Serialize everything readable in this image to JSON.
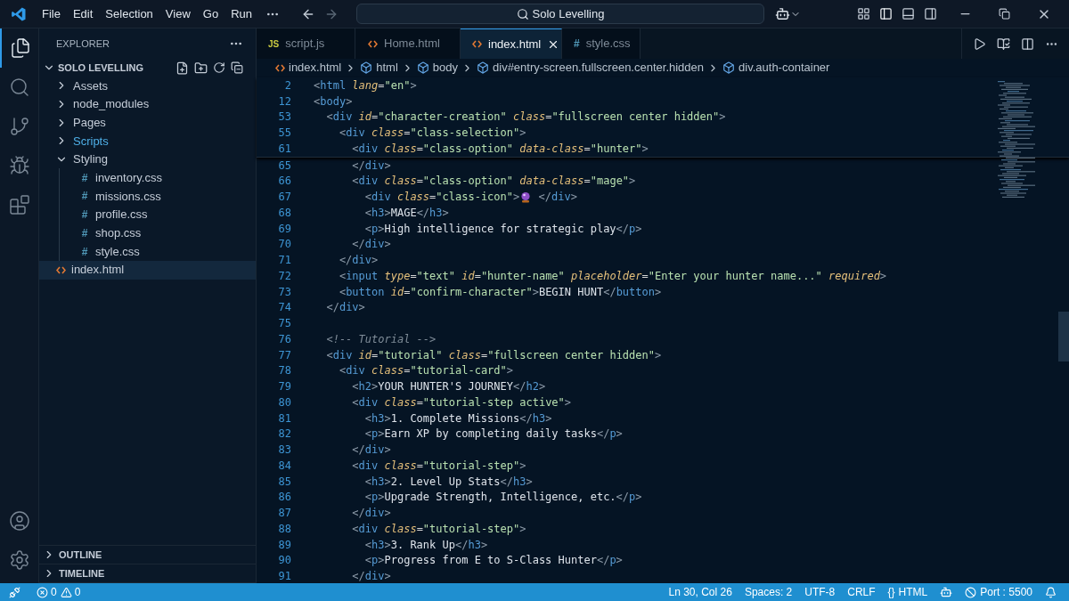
{
  "title_bar": {
    "menus": [
      "File",
      "Edit",
      "Selection",
      "View",
      "Go",
      "Run"
    ],
    "search": {
      "value": "Solo Levelling"
    }
  },
  "activity_bar": [
    {
      "kind": "files",
      "selected": true
    },
    {
      "kind": "search",
      "selected": false
    },
    {
      "kind": "source-control",
      "selected": false
    },
    {
      "kind": "debug",
      "selected": false
    },
    {
      "kind": "extensions",
      "selected": false
    }
  ],
  "explorer": {
    "title": "EXPLORER",
    "project": "SOLO LEVELLING",
    "tree": [
      {
        "name": "Assets",
        "kind": "folder",
        "expanded": false,
        "selected": false,
        "color": "#c5cdd8"
      },
      {
        "name": "node_modules",
        "kind": "folder",
        "expanded": false,
        "selected": false,
        "color": "#c5cdd8"
      },
      {
        "name": "Pages",
        "kind": "folder",
        "expanded": false,
        "selected": false,
        "color": "#c5cdd8"
      },
      {
        "name": "Scripts",
        "kind": "folder",
        "expanded": false,
        "selected": false,
        "color": "#4fb0e8"
      },
      {
        "name": "Styling",
        "kind": "folder",
        "expanded": true,
        "selected": false,
        "color": "#c5cdd8",
        "children": [
          {
            "name": "inventory.css",
            "kind": "css",
            "badge": "#",
            "selected": false,
            "color": "#c5cdd8"
          },
          {
            "name": "missions.css",
            "kind": "css",
            "badge": "#",
            "selected": false,
            "color": "#c5cdd8"
          },
          {
            "name": "profile.css",
            "kind": "css",
            "badge": "#",
            "selected": false,
            "color": "#c5cdd8"
          },
          {
            "name": "shop.css",
            "kind": "css",
            "badge": "#",
            "selected": false,
            "color": "#c5cdd8"
          },
          {
            "name": "style.css",
            "kind": "css",
            "badge": "#",
            "selected": false,
            "color": "#c5cdd8"
          }
        ]
      },
      {
        "name": "index.html",
        "kind": "html",
        "selected": true,
        "color": "#c5cdd8"
      }
    ],
    "sections": [
      "OUTLINE",
      "TIMELINE"
    ]
  },
  "tabs": [
    {
      "label": "script.js",
      "kind": "js",
      "badge": "JS",
      "selected": false
    },
    {
      "label": "Home.html",
      "kind": "html",
      "selected": false
    },
    {
      "label": "index.html",
      "kind": "html",
      "selected": true
    },
    {
      "label": "style.css",
      "kind": "css",
      "badge": "#",
      "selected": false
    }
  ],
  "breadcrumb": [
    {
      "label": "index.html",
      "kind": "file"
    },
    {
      "label": "html",
      "kind": "element"
    },
    {
      "label": "body",
      "kind": "element"
    },
    {
      "label": "div#entry-screen.fullscreen.center.hidden",
      "kind": "element"
    },
    {
      "label": "div.auth-container",
      "kind": "element"
    }
  ],
  "sticky_lines": [
    {
      "n": "2",
      "tokens": [
        {
          "kind": "bracket",
          "text": "<"
        },
        {
          "kind": "tag",
          "text": "html"
        },
        {
          "kind": "attr",
          "text": " lang"
        },
        {
          "kind": "eq",
          "text": "="
        },
        {
          "kind": "string",
          "text": "\"en\""
        },
        {
          "kind": "bracket",
          "text": ">"
        }
      ]
    },
    {
      "n": "12",
      "tokens": [
        {
          "kind": "bracket",
          "text": "<"
        },
        {
          "kind": "tag",
          "text": "body"
        },
        {
          "kind": "bracket",
          "text": ">"
        }
      ]
    },
    {
      "n": "53",
      "tokens": [
        {
          "kind": "bracket",
          "text": "  <"
        },
        {
          "kind": "tag",
          "text": "div"
        },
        {
          "kind": "attr",
          "text": " id"
        },
        {
          "kind": "eq",
          "text": "="
        },
        {
          "kind": "string",
          "text": "\"character-creation\""
        },
        {
          "kind": "attr",
          "text": " class"
        },
        {
          "kind": "eq",
          "text": "="
        },
        {
          "kind": "string",
          "text": "\"fullscreen center hidden\""
        },
        {
          "kind": "bracket",
          "text": ">"
        }
      ]
    },
    {
      "n": "55",
      "tokens": [
        {
          "kind": "bracket",
          "text": "    <"
        },
        {
          "kind": "tag",
          "text": "div"
        },
        {
          "kind": "attr",
          "text": " class"
        },
        {
          "kind": "eq",
          "text": "="
        },
        {
          "kind": "string",
          "text": "\"class-selection\""
        },
        {
          "kind": "bracket",
          "text": ">"
        }
      ]
    },
    {
      "n": "61",
      "tokens": [
        {
          "kind": "bracket",
          "text": "      <"
        },
        {
          "kind": "tag",
          "text": "div"
        },
        {
          "kind": "attr",
          "text": " class"
        },
        {
          "kind": "eq",
          "text": "="
        },
        {
          "kind": "string",
          "text": "\"class-option\""
        },
        {
          "kind": "attr",
          "text": " data-class"
        },
        {
          "kind": "eq",
          "text": "="
        },
        {
          "kind": "string",
          "text": "\"hunter\""
        },
        {
          "kind": "bracket",
          "text": ">"
        }
      ]
    }
  ],
  "lines": [
    {
      "n": "65",
      "tokens": [
        {
          "kind": "bracket",
          "text": "      </"
        },
        {
          "kind": "tag",
          "text": "div"
        },
        {
          "kind": "bracket",
          "text": ">"
        }
      ]
    },
    {
      "n": "66",
      "tokens": [
        {
          "kind": "bracket",
          "text": "      <"
        },
        {
          "kind": "tag",
          "text": "div"
        },
        {
          "kind": "attr",
          "text": " class"
        },
        {
          "kind": "eq",
          "text": "="
        },
        {
          "kind": "string",
          "text": "\"class-option\""
        },
        {
          "kind": "attr",
          "text": " data-class"
        },
        {
          "kind": "eq",
          "text": "="
        },
        {
          "kind": "string",
          "text": "\"mage\""
        },
        {
          "kind": "bracket",
          "text": ">"
        }
      ]
    },
    {
      "n": "67",
      "tokens": [
        {
          "kind": "bracket",
          "text": "        <"
        },
        {
          "kind": "tag",
          "text": "div"
        },
        {
          "kind": "attr",
          "text": " class"
        },
        {
          "kind": "eq",
          "text": "="
        },
        {
          "kind": "string",
          "text": "\"class-icon\""
        },
        {
          "kind": "bracket",
          "text": ">"
        },
        {
          "kind": "icon"
        },
        {
          "kind": "bracket",
          "text": " </"
        },
        {
          "kind": "tag",
          "text": "div"
        },
        {
          "kind": "bracket",
          "text": ">"
        }
      ]
    },
    {
      "n": "68",
      "tokens": [
        {
          "kind": "bracket",
          "text": "        <"
        },
        {
          "kind": "tag",
          "text": "h3"
        },
        {
          "kind": "bracket",
          "text": ">"
        },
        {
          "kind": "text",
          "text": "MAGE"
        },
        {
          "kind": "bracket",
          "text": "</"
        },
        {
          "kind": "tag",
          "text": "h3"
        },
        {
          "kind": "bracket",
          "text": ">"
        }
      ]
    },
    {
      "n": "69",
      "tokens": [
        {
          "kind": "bracket",
          "text": "        <"
        },
        {
          "kind": "tag",
          "text": "p"
        },
        {
          "kind": "bracket",
          "text": ">"
        },
        {
          "kind": "text",
          "text": "High intelligence for strategic play"
        },
        {
          "kind": "bracket",
          "text": "</"
        },
        {
          "kind": "tag",
          "text": "p"
        },
        {
          "kind": "bracket",
          "text": ">"
        }
      ]
    },
    {
      "n": "70",
      "tokens": [
        {
          "kind": "bracket",
          "text": "      </"
        },
        {
          "kind": "tag",
          "text": "div"
        },
        {
          "kind": "bracket",
          "text": ">"
        }
      ]
    },
    {
      "n": "71",
      "tokens": [
        {
          "kind": "bracket",
          "text": "    </"
        },
        {
          "kind": "tag",
          "text": "div"
        },
        {
          "kind": "bracket",
          "text": ">"
        }
      ]
    },
    {
      "n": "72",
      "tokens": [
        {
          "kind": "bracket",
          "text": "    <"
        },
        {
          "kind": "tag",
          "text": "input"
        },
        {
          "kind": "attr",
          "text": " type"
        },
        {
          "kind": "eq",
          "text": "="
        },
        {
          "kind": "string",
          "text": "\"text\""
        },
        {
          "kind": "attr",
          "text": " id"
        },
        {
          "kind": "eq",
          "text": "="
        },
        {
          "kind": "string",
          "text": "\"hunter-name\""
        },
        {
          "kind": "attr",
          "text": " placeholder"
        },
        {
          "kind": "eq",
          "text": "="
        },
        {
          "kind": "string",
          "text": "\"Enter your hunter name...\""
        },
        {
          "kind": "attr",
          "text": " required"
        },
        {
          "kind": "bracket",
          "text": ">"
        }
      ]
    },
    {
      "n": "73",
      "tokens": [
        {
          "kind": "bracket",
          "text": "    <"
        },
        {
          "kind": "tag",
          "text": "button"
        },
        {
          "kind": "attr",
          "text": " id"
        },
        {
          "kind": "eq",
          "text": "="
        },
        {
          "kind": "string",
          "text": "\"confirm-character\""
        },
        {
          "kind": "bracket",
          "text": ">"
        },
        {
          "kind": "text",
          "text": "BEGIN HUNT"
        },
        {
          "kind": "bracket",
          "text": "</"
        },
        {
          "kind": "tag",
          "text": "button"
        },
        {
          "kind": "bracket",
          "text": ">"
        }
      ]
    },
    {
      "n": "74",
      "tokens": [
        {
          "kind": "bracket",
          "text": "  </"
        },
        {
          "kind": "tag",
          "text": "div"
        },
        {
          "kind": "bracket",
          "text": ">"
        }
      ]
    },
    {
      "n": "75"
    },
    {
      "n": "76",
      "tokens": [
        {
          "kind": "comment",
          "text": "  <!-- Tutorial -->"
        }
      ]
    },
    {
      "n": "77",
      "tokens": [
        {
          "kind": "bracket",
          "text": "  <"
        },
        {
          "kind": "tag",
          "text": "div"
        },
        {
          "kind": "attr",
          "text": " id"
        },
        {
          "kind": "eq",
          "text": "="
        },
        {
          "kind": "string",
          "text": "\"tutorial\""
        },
        {
          "kind": "attr",
          "text": " class"
        },
        {
          "kind": "eq",
          "text": "="
        },
        {
          "kind": "string",
          "text": "\"fullscreen center hidden\""
        },
        {
          "kind": "bracket",
          "text": ">"
        }
      ]
    },
    {
      "n": "78",
      "tokens": [
        {
          "kind": "bracket",
          "text": "    <"
        },
        {
          "kind": "tag",
          "text": "div"
        },
        {
          "kind": "attr",
          "text": " class"
        },
        {
          "kind": "eq",
          "text": "="
        },
        {
          "kind": "string",
          "text": "\"tutorial-card\""
        },
        {
          "kind": "bracket",
          "text": ">"
        }
      ]
    },
    {
      "n": "79",
      "tokens": [
        {
          "kind": "bracket",
          "text": "      <"
        },
        {
          "kind": "tag",
          "text": "h2"
        },
        {
          "kind": "bracket",
          "text": ">"
        },
        {
          "kind": "text",
          "text": "YOUR HUNTER'S JOURNEY"
        },
        {
          "kind": "bracket",
          "text": "</"
        },
        {
          "kind": "tag",
          "text": "h2"
        },
        {
          "kind": "bracket",
          "text": ">"
        }
      ]
    },
    {
      "n": "80",
      "tokens": [
        {
          "kind": "bracket",
          "text": "      <"
        },
        {
          "kind": "tag",
          "text": "div"
        },
        {
          "kind": "attr",
          "text": " class"
        },
        {
          "kind": "eq",
          "text": "="
        },
        {
          "kind": "string",
          "text": "\"tutorial-step active\""
        },
        {
          "kind": "bracket",
          "text": ">"
        }
      ]
    },
    {
      "n": "81",
      "tokens": [
        {
          "kind": "bracket",
          "text": "        <"
        },
        {
          "kind": "tag",
          "text": "h3"
        },
        {
          "kind": "bracket",
          "text": ">"
        },
        {
          "kind": "text",
          "text": "1. Complete Missions"
        },
        {
          "kind": "bracket",
          "text": "</"
        },
        {
          "kind": "tag",
          "text": "h3"
        },
        {
          "kind": "bracket",
          "text": ">"
        }
      ]
    },
    {
      "n": "82",
      "tokens": [
        {
          "kind": "bracket",
          "text": "        <"
        },
        {
          "kind": "tag",
          "text": "p"
        },
        {
          "kind": "bracket",
          "text": ">"
        },
        {
          "kind": "text",
          "text": "Earn XP by completing daily tasks"
        },
        {
          "kind": "bracket",
          "text": "</"
        },
        {
          "kind": "tag",
          "text": "p"
        },
        {
          "kind": "bracket",
          "text": ">"
        }
      ]
    },
    {
      "n": "83",
      "tokens": [
        {
          "kind": "bracket",
          "text": "      </"
        },
        {
          "kind": "tag",
          "text": "div"
        },
        {
          "kind": "bracket",
          "text": ">"
        }
      ]
    },
    {
      "n": "84",
      "tokens": [
        {
          "kind": "bracket",
          "text": "      <"
        },
        {
          "kind": "tag",
          "text": "div"
        },
        {
          "kind": "attr",
          "text": " class"
        },
        {
          "kind": "eq",
          "text": "="
        },
        {
          "kind": "string",
          "text": "\"tutorial-step\""
        },
        {
          "kind": "bracket",
          "text": ">"
        }
      ]
    },
    {
      "n": "85",
      "tokens": [
        {
          "kind": "bracket",
          "text": "        <"
        },
        {
          "kind": "tag",
          "text": "h3"
        },
        {
          "kind": "bracket",
          "text": ">"
        },
        {
          "kind": "text",
          "text": "2. Level Up Stats"
        },
        {
          "kind": "bracket",
          "text": "</"
        },
        {
          "kind": "tag",
          "text": "h3"
        },
        {
          "kind": "bracket",
          "text": ">"
        }
      ]
    },
    {
      "n": "86",
      "tokens": [
        {
          "kind": "bracket",
          "text": "        <"
        },
        {
          "kind": "tag",
          "text": "p"
        },
        {
          "kind": "bracket",
          "text": ">"
        },
        {
          "kind": "text",
          "text": "Upgrade Strength, Intelligence, etc."
        },
        {
          "kind": "bracket",
          "text": "</"
        },
        {
          "kind": "tag",
          "text": "p"
        },
        {
          "kind": "bracket",
          "text": ">"
        }
      ]
    },
    {
      "n": "87",
      "tokens": [
        {
          "kind": "bracket",
          "text": "      </"
        },
        {
          "kind": "tag",
          "text": "div"
        },
        {
          "kind": "bracket",
          "text": ">"
        }
      ]
    },
    {
      "n": "88",
      "tokens": [
        {
          "kind": "bracket",
          "text": "      <"
        },
        {
          "kind": "tag",
          "text": "div"
        },
        {
          "kind": "attr",
          "text": " class"
        },
        {
          "kind": "eq",
          "text": "="
        },
        {
          "kind": "string",
          "text": "\"tutorial-step\""
        },
        {
          "kind": "bracket",
          "text": ">"
        }
      ]
    },
    {
      "n": "89",
      "tokens": [
        {
          "kind": "bracket",
          "text": "        <"
        },
        {
          "kind": "tag",
          "text": "h3"
        },
        {
          "kind": "bracket",
          "text": ">"
        },
        {
          "kind": "text",
          "text": "3. Rank Up"
        },
        {
          "kind": "bracket",
          "text": "</"
        },
        {
          "kind": "tag",
          "text": "h3"
        },
        {
          "kind": "bracket",
          "text": ">"
        }
      ]
    },
    {
      "n": "90",
      "tokens": [
        {
          "kind": "bracket",
          "text": "        <"
        },
        {
          "kind": "tag",
          "text": "p"
        },
        {
          "kind": "bracket",
          "text": ">"
        },
        {
          "kind": "text",
          "text": "Progress from E to S-Class Hunter"
        },
        {
          "kind": "bracket",
          "text": "</"
        },
        {
          "kind": "tag",
          "text": "p"
        },
        {
          "kind": "bracket",
          "text": ">"
        }
      ]
    },
    {
      "n": "91",
      "tokens": [
        {
          "kind": "bracket",
          "text": "      </"
        },
        {
          "kind": "tag",
          "text": "div"
        },
        {
          "kind": "bracket",
          "text": ">"
        }
      ]
    }
  ],
  "status_bar": {
    "errors": "0",
    "warnings": "0",
    "right": [
      {
        "kind": "text",
        "label": "Ln 30, Col 26"
      },
      {
        "kind": "text",
        "label": "Spaces: 2"
      },
      {
        "kind": "text",
        "label": "UTF-8"
      },
      {
        "kind": "text",
        "label": "CRLF"
      },
      {
        "kind": "language",
        "glyph": "{}",
        "label": "HTML"
      },
      {
        "kind": "copilot"
      },
      {
        "kind": "port",
        "label": "Port : 5500"
      },
      {
        "kind": "bell"
      }
    ]
  }
}
